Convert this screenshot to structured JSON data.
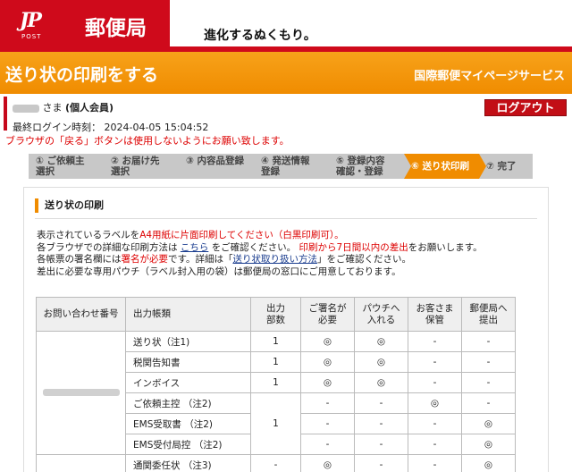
{
  "header": {
    "logo_mark": "JP",
    "logo_post": "POST",
    "logo_name": "郵便局",
    "slogan": "進化するぬくもり。"
  },
  "banner": {
    "title": "送り状の印刷をする",
    "service": "国際郵便マイページサービス"
  },
  "user": {
    "honorific": "さま",
    "member_type": "(個人会員)",
    "last_login_label": "最終ログイン時刻：",
    "last_login_value": "2024-04-05 15:04:52",
    "logout_label": "ログアウト",
    "warning": "ブラウザの「戻る」ボタンは使用しないようにお願い致します。"
  },
  "steps": [
    {
      "label": "① ご依頼主\n選択",
      "active": false
    },
    {
      "label": "② お届け先\n選択",
      "active": false
    },
    {
      "label": "③ 内容品登録",
      "active": false
    },
    {
      "label": "④ 発送情報\n登録",
      "active": false
    },
    {
      "label": "⑤ 登録内容\n確認・登録",
      "active": false
    },
    {
      "label": "⑥ 送り状印刷",
      "active": true
    },
    {
      "label": "⑦ 完了",
      "active": false
    }
  ],
  "section": {
    "title": "送り状の印刷",
    "line1_a": "表示されているラベルを",
    "line1_b": "A4用紙に片面印刷してください（白黒印刷可）。",
    "line2_a": "各ブラウザでの詳細な印刷方法は",
    "line2_link": "こちら",
    "line2_b": "をご確認ください。",
    "line2_c": "印刷から7日間以内の差出",
    "line2_d": "をお願いします。",
    "line3_a": "各帳票の署名欄には",
    "line3_b": "署名が必要",
    "line3_c": "です。詳細は「",
    "line3_link": "送り状取り扱い方法",
    "line3_d": "」をご確認ください。",
    "line4": "差出に必要な専用パウチ（ラベル封入用の袋）は郵便局の窓口にご用意しております。"
  },
  "table": {
    "headers": [
      "お問い合わせ番号",
      "出力帳類",
      "出力\n部数",
      "ご署名が\n必要",
      "パウチへ\n入れる",
      "お客さま\n保管",
      "郵便局へ\n提出"
    ],
    "rows": [
      {
        "doc": "送り状（注1)",
        "copies": "1",
        "sign": "◎",
        "pouch": "◎",
        "keep": "-",
        "submit": "-"
      },
      {
        "doc": "税関告知書",
        "copies": "1",
        "sign": "◎",
        "pouch": "◎",
        "keep": "-",
        "submit": "-"
      },
      {
        "doc": "インボイス",
        "copies": "1",
        "sign": "◎",
        "pouch": "◎",
        "keep": "-",
        "submit": "-"
      },
      {
        "doc": "ご依頼主控 （注2)",
        "copies": "",
        "sign": "-",
        "pouch": "-",
        "keep": "◎",
        "submit": "-"
      },
      {
        "doc": "EMS受取書 （注2)",
        "copies": "1",
        "sign": "-",
        "pouch": "-",
        "keep": "-",
        "submit": "◎"
      },
      {
        "doc": "EMS受付局控 （注2)",
        "copies": "",
        "sign": "-",
        "pouch": "-",
        "keep": "-",
        "submit": "◎"
      },
      {
        "doc": "通関委任状 （注3)",
        "copies": "-",
        "sign": "◎",
        "pouch": "-",
        "keep": "-",
        "submit": "◎"
      }
    ]
  }
}
